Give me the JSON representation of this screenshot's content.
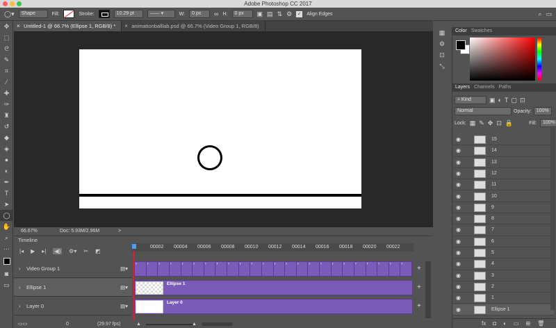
{
  "app_title": "Adobe Photoshop CC 2017",
  "options": {
    "tool_mode": "Shape",
    "fill_label": "Fill:",
    "stroke_label": "Stroke:",
    "stroke_width": "10.29 pt",
    "w_label": "W:",
    "w_value": "0 px",
    "h_label": "H:",
    "h_value": "0 px",
    "align_edges": "Align Edges"
  },
  "doc_tabs": [
    {
      "label": "Untitled-1 @ 66.7% (Ellipse 1, RGB/8) *"
    },
    {
      "label": "animationballlab.psd @ 66.7% (Video Group 1, RGB/8)"
    }
  ],
  "status": {
    "zoom": "66.67%",
    "doc": "Doc: 5.93M/2.96M",
    "arrow": ">"
  },
  "timeline": {
    "title": "Timeline",
    "ruler": [
      "00002",
      "00004",
      "00006",
      "00008",
      "00010",
      "00012",
      "00014",
      "00016",
      "00018",
      "00020",
      "00022"
    ],
    "tracks": [
      {
        "label": "Video Group 1"
      },
      {
        "label": "Ellipse 1",
        "clip": "Ellipse 1"
      },
      {
        "label": "Layer 0",
        "clip": "Layer 0"
      }
    ],
    "frame_index": "0",
    "fps": "(29.97 fps)"
  },
  "color_panel": {
    "tabs": [
      "Color",
      "Swatches"
    ],
    "fg": "#000000",
    "bg": "#ffffff"
  },
  "layers_panel": {
    "tabs": [
      "Layers",
      "Channels",
      "Paths"
    ],
    "kind": "Kind",
    "blend": "Normal",
    "opacity_label": "Opacity:",
    "opacity": "100%",
    "lock_label": "Lock:",
    "fill_label": "Fill:",
    "fill": "100%",
    "layers": [
      "15",
      "14",
      "13",
      "12",
      "11",
      "10",
      "9",
      "8",
      "7",
      "6",
      "5",
      "4",
      "3",
      "2",
      "1",
      "Ellipse 1"
    ]
  },
  "accent_colors": {
    "clip": "#7b5bb8",
    "playhead": "#4aa0f0",
    "playline": "#dd2233"
  }
}
